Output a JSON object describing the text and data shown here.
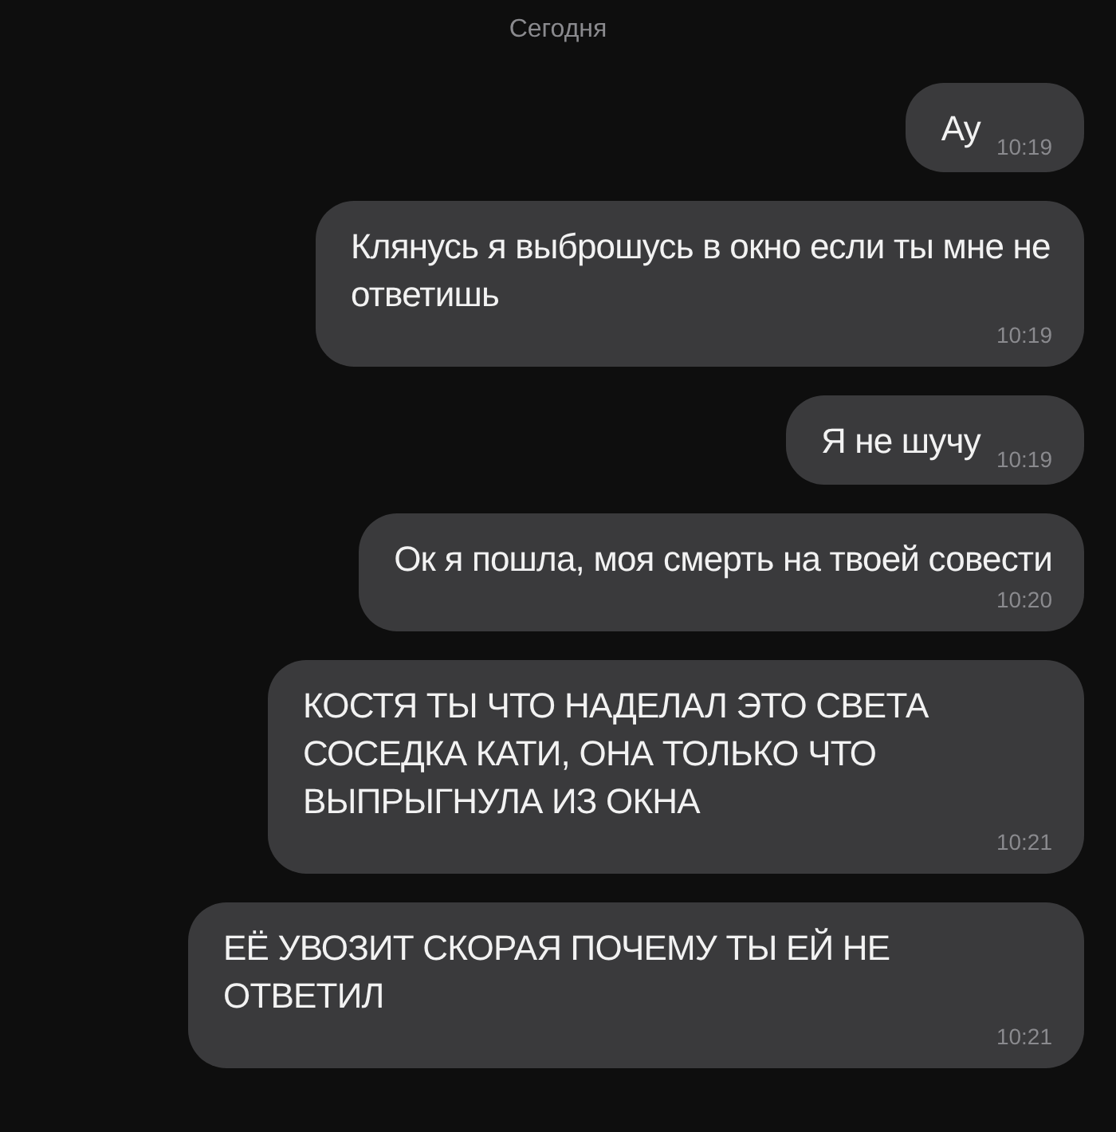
{
  "date_header": "Сегодня",
  "messages": [
    {
      "text": "Ау",
      "time": "10:19",
      "kind": "short"
    },
    {
      "text": "Клянусь я выброшусь в окно если ты мне не ответишь",
      "time": "10:19",
      "kind": "long"
    },
    {
      "text": "Я не шучу",
      "time": "10:19",
      "kind": "short"
    },
    {
      "text": "Ок я пошла, моя смерть на твоей совести",
      "time": "10:20",
      "kind": "long"
    },
    {
      "text": "КОСТЯ ТЫ ЧТО НАДЕЛАЛ ЭТО СВЕТА СОСЕДКА КАТИ, ОНА ТОЛЬКО ЧТО ВЫПРЫГНУЛА ИЗ ОКНА",
      "time": "10:21",
      "kind": "long"
    },
    {
      "text": "ЕЁ УВОЗИТ СКОРАЯ ПОЧЕМУ ТЫ ЕЙ НЕ ОТВЕТИЛ",
      "time": "10:21",
      "kind": "long"
    }
  ]
}
